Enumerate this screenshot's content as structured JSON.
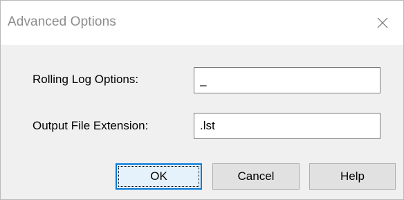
{
  "window": {
    "title": "Advanced Options",
    "close_icon": "close-icon"
  },
  "form": {
    "rolling_log": {
      "label": "Rolling Log Options:",
      "value": "_"
    },
    "output_ext": {
      "label": "Output File Extension:",
      "value": ".lst"
    }
  },
  "buttons": {
    "ok": "OK",
    "cancel": "Cancel",
    "help": "Help"
  },
  "colors": {
    "accent": "#0078d7",
    "dialog_bg": "#f0f0f0",
    "titlebar_bg": "#ffffff"
  }
}
